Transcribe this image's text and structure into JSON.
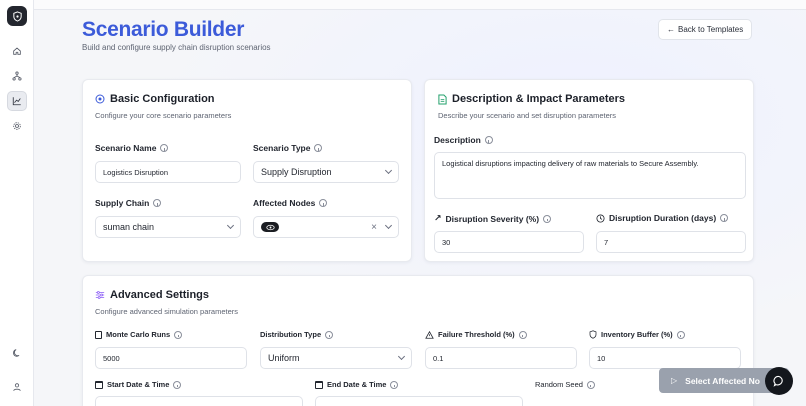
{
  "header": {
    "title": "Scenario Builder",
    "subtitle": "Build and configure supply chain disruption scenarios",
    "back_button": "Back to Templates"
  },
  "basic": {
    "title": "Basic Configuration",
    "subtitle": "Configure your core scenario parameters",
    "scenario_name_label": "Scenario Name",
    "scenario_name_value": "Logistics Disruption",
    "scenario_type_label": "Scenario Type",
    "scenario_type_value": "Supply Disruption",
    "supply_chain_label": "Supply Chain",
    "supply_chain_value": "suman chain",
    "affected_nodes_label": "Affected Nodes"
  },
  "impact": {
    "title": "Description & Impact Parameters",
    "subtitle": "Describe your scenario and set disruption parameters",
    "description_label": "Description",
    "description_value": "Logistical disruptions impacting delivery of raw materials to Secure Assembly.",
    "severity_label": "Disruption Severity (%)",
    "severity_value": "30",
    "duration_label": "Disruption Duration (days)",
    "duration_value": "7"
  },
  "advanced": {
    "title": "Advanced Settings",
    "subtitle": "Configure advanced simulation parameters",
    "monte_carlo_label": "Monte Carlo Runs",
    "monte_carlo_value": "5000",
    "distribution_label": "Distribution Type",
    "distribution_value": "Uniform",
    "failure_label": "Failure Threshold (%)",
    "failure_value": "0.1",
    "buffer_label": "Inventory Buffer (%)",
    "buffer_value": "10",
    "start_label": "Start Date & Time",
    "end_label": "End Date & Time",
    "seed_label": "Random Seed"
  },
  "actions": {
    "select_affected": "Select Affected No"
  },
  "colors": {
    "accent": "#3c5bd9",
    "sidebar_logo": "#23262e",
    "description_icon": "#22a06b",
    "advanced_icon": "#8b5cf6"
  }
}
